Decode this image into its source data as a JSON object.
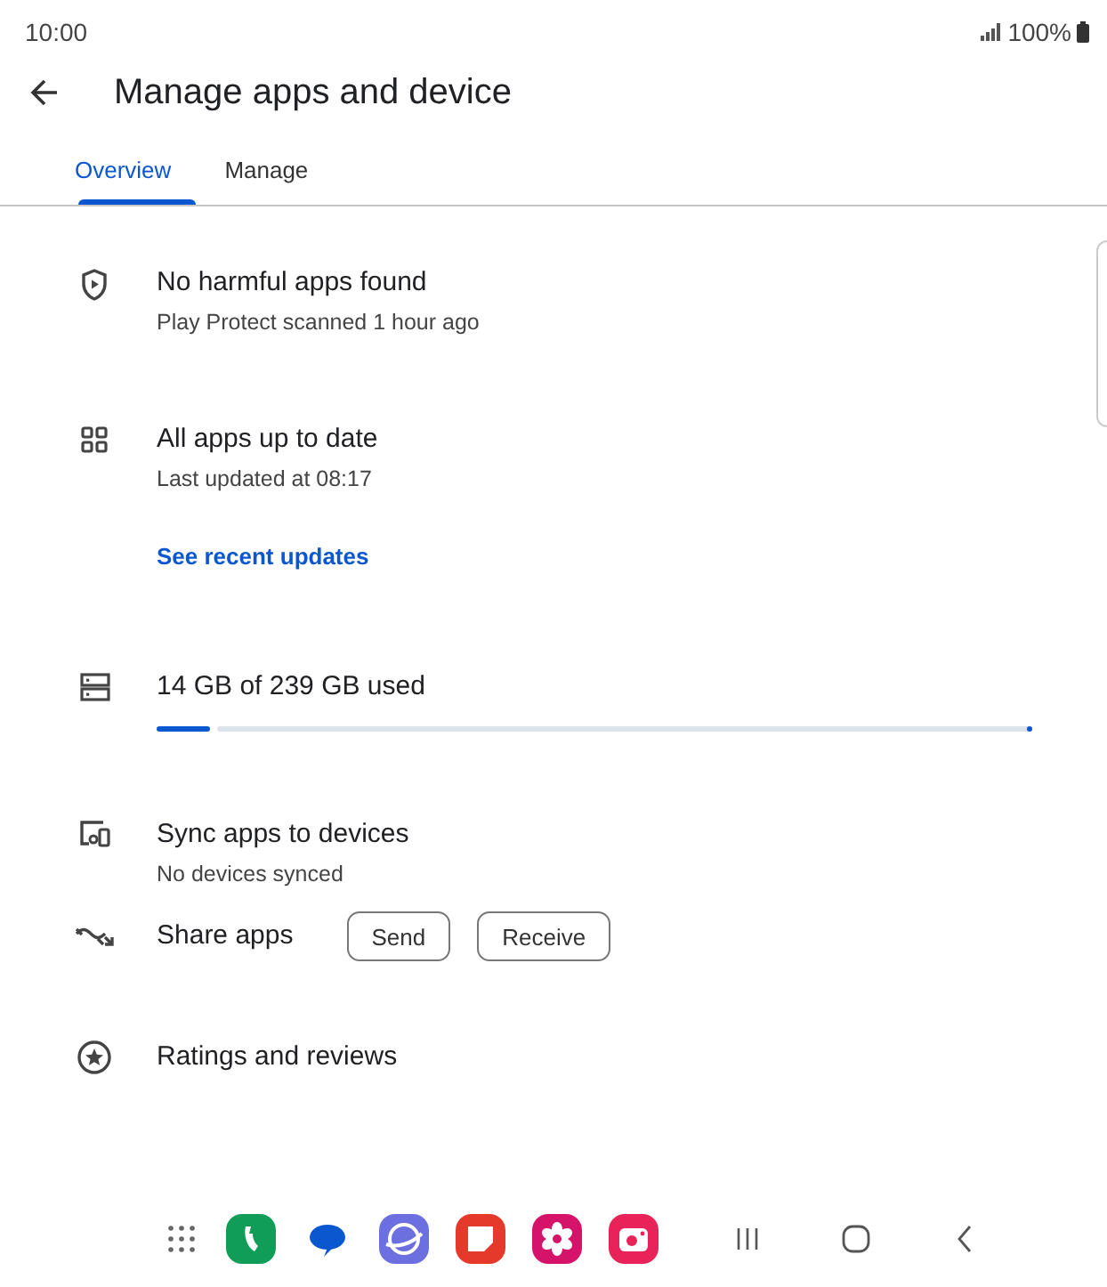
{
  "status_bar": {
    "time": "10:00",
    "battery": "100%"
  },
  "app_bar": {
    "title": "Manage apps and device"
  },
  "tabs": [
    {
      "label": "Overview",
      "selected": true
    },
    {
      "label": "Manage",
      "selected": false
    }
  ],
  "rows": [
    {
      "kind": "info",
      "title": "No harmful apps found",
      "subtitle": "Play Protect scanned 1 hour ago"
    },
    {
      "kind": "info",
      "title": "All apps up to date",
      "subtitle": "Last updated at 08:17",
      "link": "See recent updates"
    },
    {
      "kind": "storage",
      "title": "14 GB of 239 GB used",
      "level": 0.06
    },
    {
      "kind": "info",
      "title": "Sync apps to devices",
      "subtitle": "No devices synced"
    },
    {
      "kind": "share",
      "title": "Share apps",
      "buttons": [
        "Send",
        "Receive"
      ]
    },
    {
      "kind": "plain",
      "title": "Ratings and reviews"
    }
  ]
}
